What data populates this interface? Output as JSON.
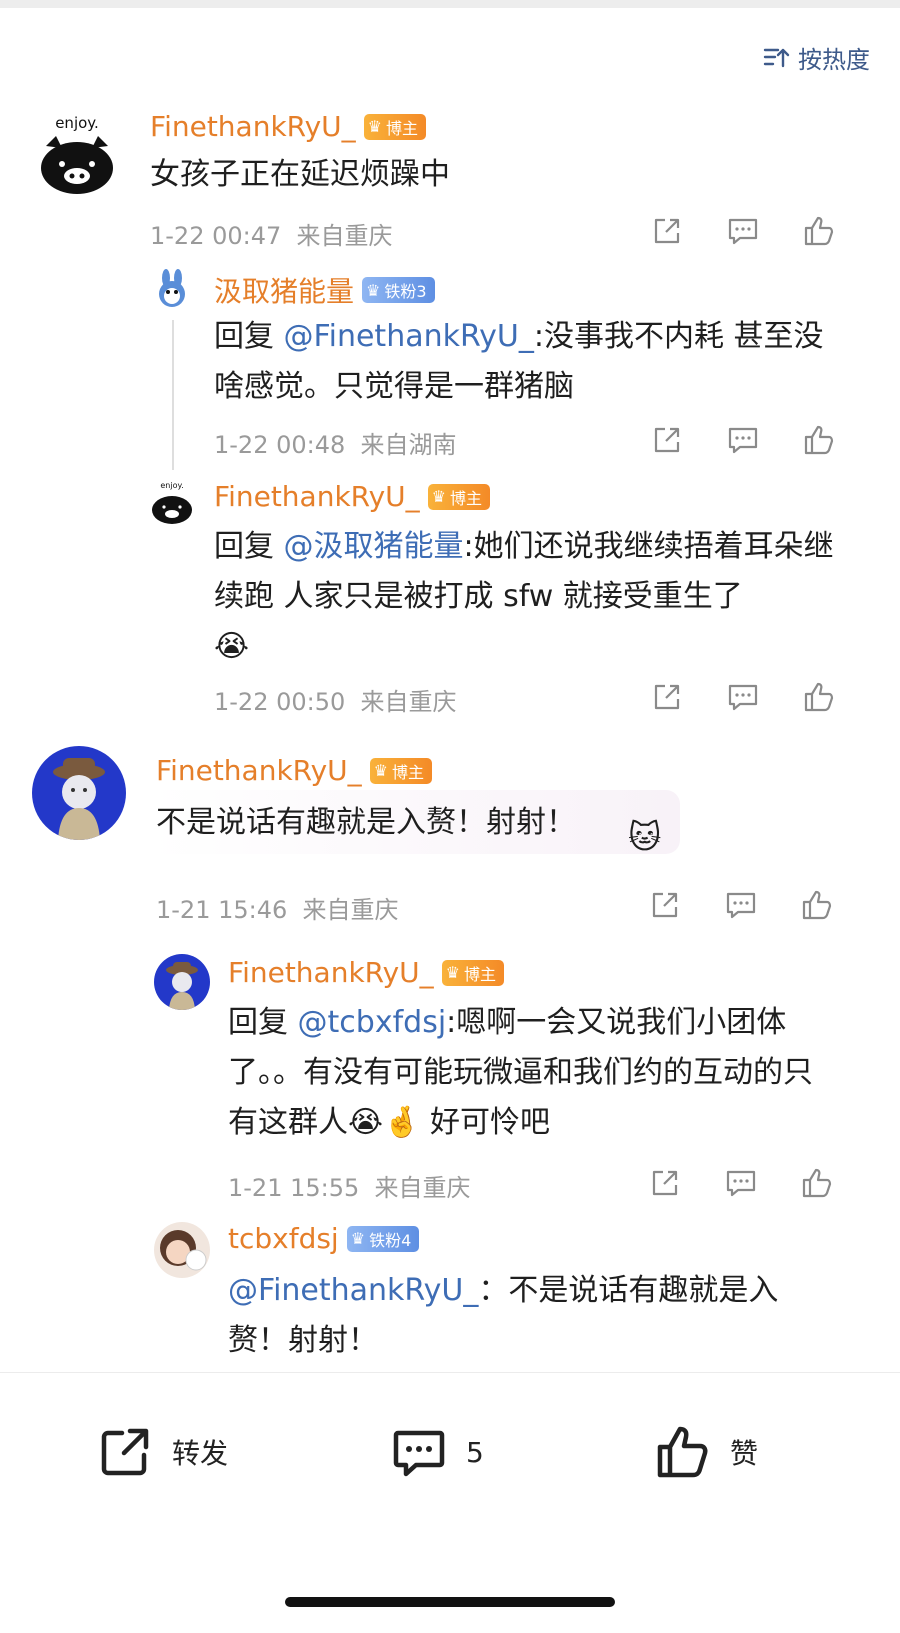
{
  "sort": {
    "label": "按热度"
  },
  "comments": [
    {
      "user": "FinethankRyU_",
      "badge": "博主",
      "text": "女孩子正在延迟烦躁中",
      "time": "1-22 00:47",
      "source": "来自重庆",
      "avatar_caption": "enjoy."
    },
    {
      "user": "汲取猪能量",
      "badge": "铁粉3",
      "reply_prefix": "回复",
      "mention": "@FinethankRyU_",
      "text": ":没事我不内耗 甚至没啥感觉。只觉得是一群猪脑",
      "time": "1-22 00:48",
      "source": "来自湖南"
    },
    {
      "user": "FinethankRyU_",
      "badge": "博主",
      "reply_prefix": "回复",
      "mention": "@汲取猪能量",
      "text": ":她们还说我继续捂着耳朵继续跑  人家只是被打成 sfw 就接受重生了",
      "emoji": "😭",
      "time": "1-22 00:50",
      "source": "来自重庆",
      "avatar_caption": "enjoy."
    },
    {
      "user": "FinethankRyU_",
      "badge": "博主",
      "text": "不是说话有趣就是入赘！射射！",
      "time": "1-21 15:46",
      "source": "来自重庆"
    },
    {
      "user": "FinethankRyU_",
      "badge": "博主",
      "reply_prefix": "回复",
      "mention": "@tcbxfdsj",
      "text": ":嗯啊一会又说我们小团体了。。有没有可能玩微逼和我们约的互动的只有这群人",
      "emoji": "😭🤞",
      "text_tail": "好可怜吧",
      "time": "1-21 15:55",
      "source": "来自重庆"
    },
    {
      "user": "tcbxfdsj",
      "badge": "铁粉4",
      "mention": "@FinethankRyU_",
      "text": "：不是说话有趣就是入赘！射射！"
    }
  ],
  "bottom": {
    "repost": "转发",
    "comment_count": "5",
    "like": "赞"
  },
  "colors": {
    "username": "#e57f2a",
    "mention": "#3e6db5",
    "meta": "#9a9a9a",
    "badge_blogger": "#f48a27",
    "badge_fan": "#5e8fe3"
  }
}
